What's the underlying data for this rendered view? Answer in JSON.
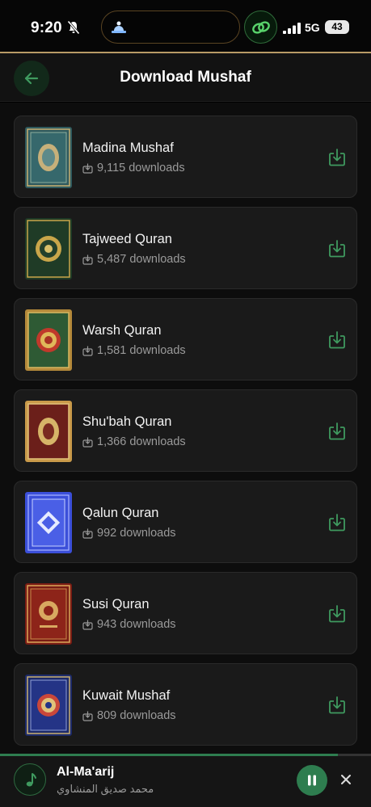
{
  "status_bar": {
    "time": "9:20",
    "network": "5G",
    "battery": "43"
  },
  "header": {
    "title": "Download Mushaf"
  },
  "colors": {
    "accent": "#2e7d4f",
    "icon_green": "#3f9a5f",
    "card_bg": "#1a1a1a"
  },
  "mushafs": [
    {
      "name": "Madina Mushaf",
      "downloads": "9,115 downloads",
      "cover": "teal",
      "icon": "download-icon"
    },
    {
      "name": "Tajweed Quran",
      "downloads": "5,487 downloads",
      "cover": "green",
      "icon": "download-icon"
    },
    {
      "name": "Warsh Quran",
      "downloads": "1,581 downloads",
      "cover": "gold-green",
      "icon": "download-icon"
    },
    {
      "name": "Shu'bah Quran",
      "downloads": "1,366 downloads",
      "cover": "maroon",
      "icon": "download-icon"
    },
    {
      "name": "Qalun Quran",
      "downloads": "992 downloads",
      "cover": "blue",
      "icon": "download-icon"
    },
    {
      "name": "Susi Quran",
      "downloads": "943 downloads",
      "cover": "red",
      "icon": "download-icon"
    },
    {
      "name": "Kuwait Mushaf",
      "downloads": "809 downloads",
      "cover": "navy",
      "icon": "download-icon"
    }
  ],
  "player": {
    "track": "Al-Ma'arij",
    "artist": "محمد صديق المنشاوي",
    "progress": 0.91
  }
}
